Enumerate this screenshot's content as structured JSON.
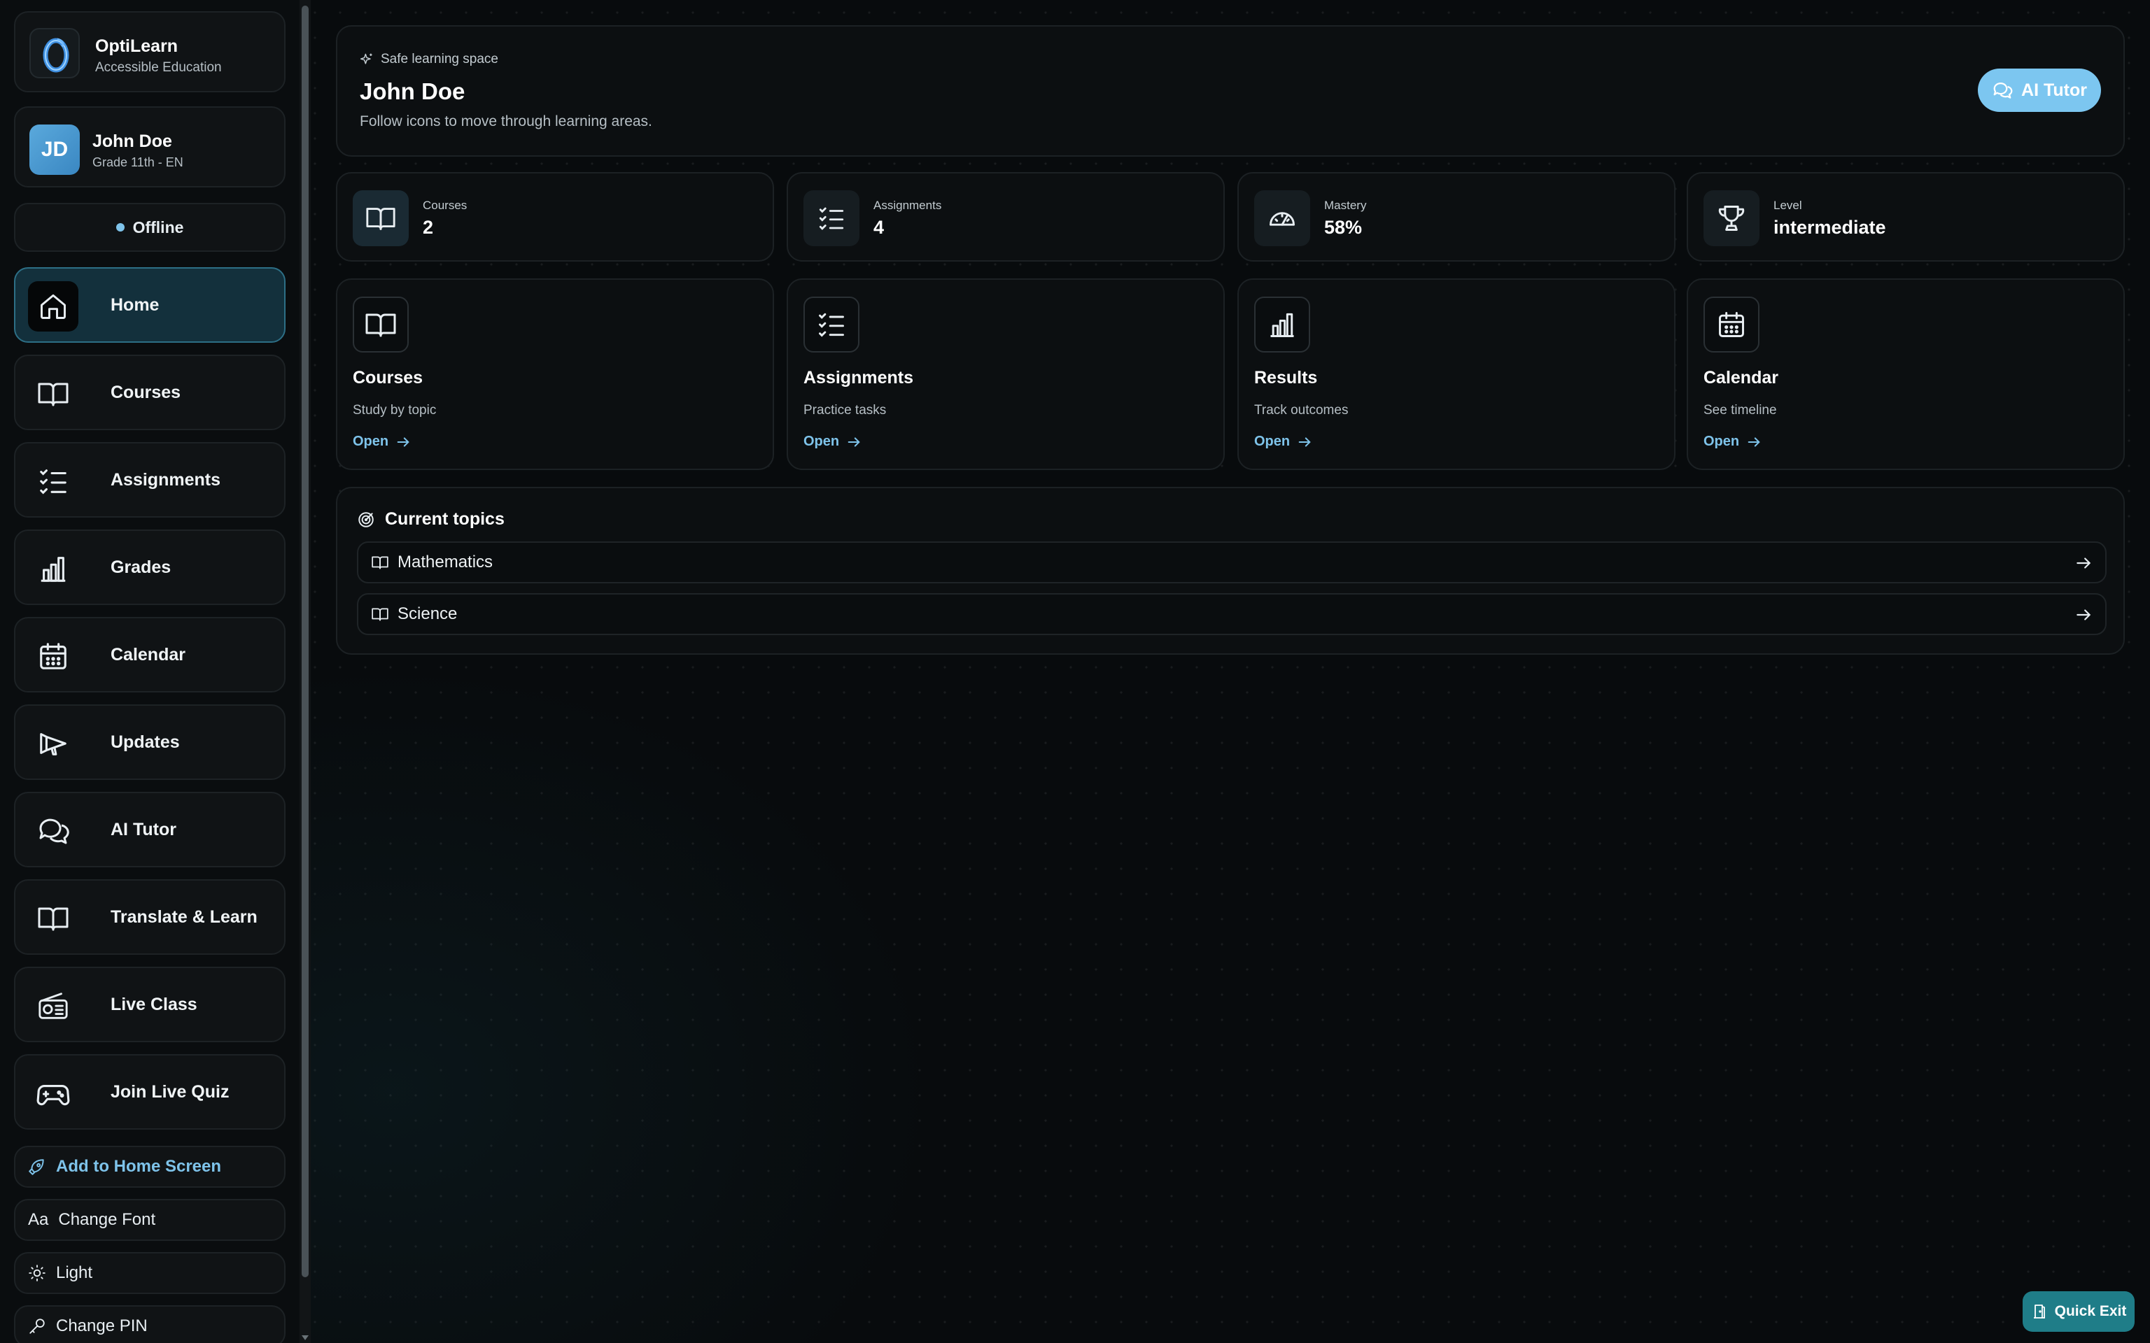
{
  "brand": {
    "name": "OptiLearn",
    "tagline": "Accessible Education"
  },
  "user": {
    "initials": "JD",
    "name": "John Doe",
    "grade": "Grade 11th - EN"
  },
  "status": {
    "label": "Offline"
  },
  "nav": [
    {
      "label": "Home",
      "icon": "home-icon",
      "active": true
    },
    {
      "label": "Courses",
      "icon": "book-icon"
    },
    {
      "label": "Assignments",
      "icon": "checklist-icon"
    },
    {
      "label": "Grades",
      "icon": "bar-chart-icon"
    },
    {
      "label": "Calendar",
      "icon": "calendar-icon"
    },
    {
      "label": "Updates",
      "icon": "megaphone-icon"
    },
    {
      "label": "AI Tutor",
      "icon": "chat-icon"
    },
    {
      "label": "Translate & Learn",
      "icon": "book-icon"
    },
    {
      "label": "Live Class",
      "icon": "radio-icon"
    },
    {
      "label": "Join Live Quiz",
      "icon": "gamepad-icon"
    }
  ],
  "utilities": {
    "add_home": "Add to Home Screen",
    "change_font": "Change Font",
    "theme": "Light",
    "change_pin": "Change PIN"
  },
  "hero": {
    "tag": "Safe learning space",
    "title": "John Doe",
    "subtitle": "Follow icons to move through learning areas.",
    "tutor_button": "AI Tutor"
  },
  "stats": [
    {
      "label": "Courses",
      "value": "2",
      "icon": "book-icon"
    },
    {
      "label": "Assignments",
      "value": "4",
      "icon": "checklist-icon"
    },
    {
      "label": "Mastery",
      "value": "58%",
      "icon": "gauge-icon"
    },
    {
      "label": "Level",
      "value": "intermediate",
      "icon": "trophy-icon"
    }
  ],
  "tiles": [
    {
      "title": "Courses",
      "subtitle": "Study by topic",
      "open": "Open",
      "icon": "book-icon"
    },
    {
      "title": "Assignments",
      "subtitle": "Practice tasks",
      "open": "Open",
      "icon": "checklist-icon"
    },
    {
      "title": "Results",
      "subtitle": "Track outcomes",
      "open": "Open",
      "icon": "bar-chart-icon"
    },
    {
      "title": "Calendar",
      "subtitle": "See timeline",
      "open": "Open",
      "icon": "calendar-icon"
    }
  ],
  "topics": {
    "heading": "Current topics",
    "items": [
      {
        "label": "Mathematics"
      },
      {
        "label": "Science"
      }
    ]
  },
  "quick_exit": "Quick Exit",
  "colors": {
    "accent": "#7ec3ea",
    "active_bg": "#13303c",
    "quick_exit_bg": "#1f7d88"
  }
}
